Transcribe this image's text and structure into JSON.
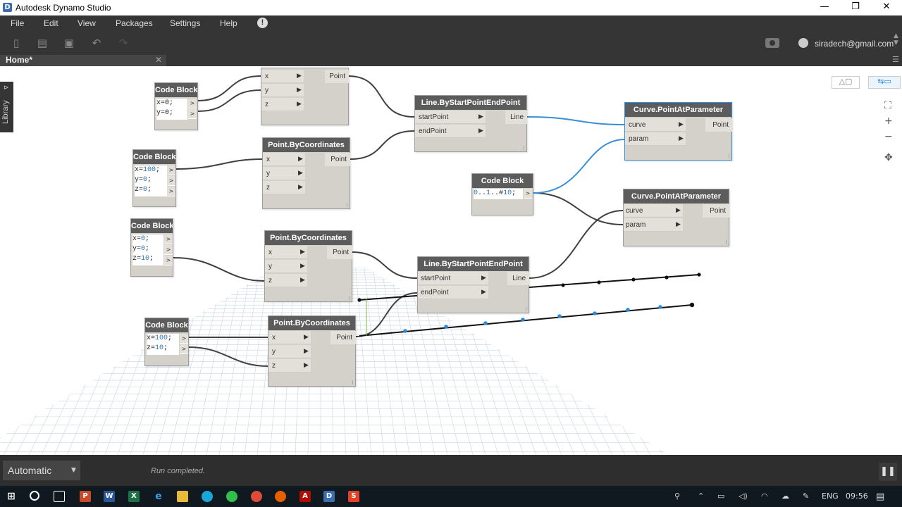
{
  "window": {
    "title": "Autodesk Dynamo Studio",
    "app_icon": "D",
    "minimize": "—",
    "restore": "❐",
    "close": "✕"
  },
  "menu": {
    "items": [
      "File",
      "Edit",
      "View",
      "Packages",
      "Settings",
      "Help"
    ],
    "alert": "!"
  },
  "toolbar": {
    "user": "siradech@gmail.com"
  },
  "tab": {
    "label": "Home*",
    "close": "✕"
  },
  "library": {
    "label": "Library",
    "expand": "⊳"
  },
  "nodes": {
    "cb1": {
      "title": "Code Block",
      "lines": [
        "x=0;",
        "y=0;"
      ]
    },
    "pt0": {
      "ports": [
        "x",
        "y",
        "z"
      ],
      "out": "Point"
    },
    "cb2": {
      "title": "Code Block",
      "lines": [
        "x=100;",
        "y=0;",
        "z=0;"
      ]
    },
    "pt1": {
      "title": "Point.ByCoordinates",
      "ports": [
        "x",
        "y",
        "z"
      ],
      "out": "Point"
    },
    "line1": {
      "title": "Line.ByStartPointEndPoint",
      "ports": [
        "startPoint",
        "endPoint"
      ],
      "out": "Line"
    },
    "curve1": {
      "title": "Curve.PointAtParameter",
      "ports": [
        "curve",
        "param"
      ],
      "out": "Point"
    },
    "cb3": {
      "title": "Code Block",
      "lines": [
        "0..1..#10;"
      ]
    },
    "curve2": {
      "title": "Curve.PointAtParameter",
      "ports": [
        "curve",
        "param"
      ],
      "out": "Point"
    },
    "cb4": {
      "title": "Code Block",
      "lines": [
        "x=0;",
        "y=0;",
        "z=10;"
      ]
    },
    "pt2": {
      "title": "Point.ByCoordinates",
      "ports": [
        "x",
        "y",
        "z"
      ],
      "out": "Point"
    },
    "line2": {
      "title": "Line.ByStartPointEndPoint",
      "ports": [
        "startPoint",
        "endPoint"
      ],
      "out": "Line"
    },
    "cb5": {
      "title": "Code Block",
      "lines": [
        "x=100;",
        "z=10;"
      ]
    },
    "pt3": {
      "title": "Point.ByCoordinates",
      "ports": [
        "x",
        "y",
        "z"
      ],
      "out": "Point"
    }
  },
  "status": {
    "run_mode": "Automatic",
    "message": "Run completed.",
    "pause": "❚❚"
  },
  "taskbar": {
    "lang": "ENG",
    "time": "09:56"
  },
  "colors": {
    "menu_bg": "#353535",
    "node_header": "#5c5c5c",
    "node_body": "#d4d1cb",
    "wire": "#404040",
    "wire_selected": "#3a8fd6",
    "number_text": "#2a72b8"
  }
}
